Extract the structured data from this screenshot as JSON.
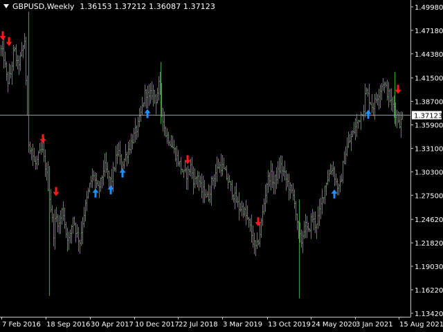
{
  "window": {
    "title": "GBPUSD,Weekly",
    "ohlc": "1.36153 1.37212 1.36087 1.37123"
  },
  "colors": {
    "background": "#000000",
    "bars": "#3f9b3a",
    "axis": "#c8c8c8",
    "text": "#ffffff",
    "price_line": "#8c9aa0",
    "price_tag_bg": "#ffffff",
    "price_tag_text": "#000000",
    "sell_arrow": "#ff1a1a",
    "buy_arrow": "#1e90ff"
  },
  "price_axis": {
    "labels": [
      "1.49980",
      "1.47180",
      "1.44380",
      "1.41500",
      "1.38700",
      "1.35900",
      "1.33100",
      "1.30300",
      "1.27500",
      "1.24620",
      "1.21820",
      "1.19030",
      "1.16220",
      "1.13420"
    ],
    "current_price": "1.37123"
  },
  "time_axis": {
    "labels": [
      "7 Feb 2016",
      "18 Sep 2016",
      "30 Apr 2017",
      "10 Dec 2017",
      "22 Jul 2018",
      "3 Mar 2019",
      "13 Oct 2019",
      "24 May 2020",
      "3 Jan 2021",
      "15 Aug 2021"
    ]
  },
  "chart_data": {
    "type": "bar",
    "symbol": "GBPUSD",
    "timeframe": "Weekly",
    "ylim": [
      1.13,
      1.508
    ],
    "price_line": 1.37123,
    "close_path": [
      [
        0,
        1.45
      ],
      [
        5,
        1.44
      ],
      [
        10,
        1.41
      ],
      [
        15,
        1.42
      ],
      [
        20,
        1.45
      ],
      [
        25,
        1.43
      ],
      [
        30,
        1.44
      ],
      [
        35,
        1.46
      ],
      [
        38,
        1.39
      ],
      [
        40,
        1.34
      ],
      [
        45,
        1.33
      ],
      [
        50,
        1.31
      ],
      [
        55,
        1.32
      ],
      [
        60,
        1.33
      ],
      [
        65,
        1.31
      ],
      [
        70,
        1.28
      ],
      [
        73,
        1.26
      ],
      [
        77,
        1.23
      ],
      [
        80,
        1.25
      ],
      [
        85,
        1.24
      ],
      [
        90,
        1.26
      ],
      [
        95,
        1.23
      ],
      [
        100,
        1.22
      ],
      [
        105,
        1.25
      ],
      [
        110,
        1.23
      ],
      [
        115,
        1.22
      ],
      [
        120,
        1.25
      ],
      [
        125,
        1.27
      ],
      [
        130,
        1.29
      ],
      [
        135,
        1.3
      ],
      [
        140,
        1.28
      ],
      [
        145,
        1.29
      ],
      [
        150,
        1.31
      ],
      [
        155,
        1.3
      ],
      [
        160,
        1.29
      ],
      [
        165,
        1.31
      ],
      [
        170,
        1.33
      ],
      [
        175,
        1.31
      ],
      [
        180,
        1.32
      ],
      [
        185,
        1.33
      ],
      [
        190,
        1.34
      ],
      [
        195,
        1.35
      ],
      [
        200,
        1.36
      ],
      [
        205,
        1.38
      ],
      [
        210,
        1.4
      ],
      [
        215,
        1.39
      ],
      [
        220,
        1.4
      ],
      [
        225,
        1.39
      ],
      [
        230,
        1.41
      ],
      [
        233,
        1.38
      ],
      [
        238,
        1.35
      ],
      [
        245,
        1.34
      ],
      [
        250,
        1.33
      ],
      [
        255,
        1.32
      ],
      [
        260,
        1.31
      ],
      [
        265,
        1.3
      ],
      [
        270,
        1.3
      ],
      [
        275,
        1.31
      ],
      [
        280,
        1.29
      ],
      [
        285,
        1.3
      ],
      [
        290,
        1.28
      ],
      [
        295,
        1.28
      ],
      [
        300,
        1.27
      ],
      [
        305,
        1.29
      ],
      [
        310,
        1.3
      ],
      [
        315,
        1.31
      ],
      [
        320,
        1.31
      ],
      [
        325,
        1.3
      ],
      [
        330,
        1.29
      ],
      [
        335,
        1.28
      ],
      [
        340,
        1.27
      ],
      [
        345,
        1.26
      ],
      [
        350,
        1.26
      ],
      [
        355,
        1.25
      ],
      [
        360,
        1.24
      ],
      [
        365,
        1.22
      ],
      [
        370,
        1.21
      ],
      [
        375,
        1.23
      ],
      [
        380,
        1.26
      ],
      [
        385,
        1.29
      ],
      [
        390,
        1.3
      ],
      [
        395,
        1.29
      ],
      [
        400,
        1.3
      ],
      [
        405,
        1.31
      ],
      [
        410,
        1.3
      ],
      [
        415,
        1.29
      ],
      [
        420,
        1.28
      ],
      [
        425,
        1.27
      ],
      [
        430,
        1.23
      ],
      [
        435,
        1.22
      ],
      [
        440,
        1.24
      ],
      [
        445,
        1.23
      ],
      [
        450,
        1.25
      ],
      [
        455,
        1.24
      ],
      [
        460,
        1.25
      ],
      [
        465,
        1.27
      ],
      [
        470,
        1.29
      ],
      [
        475,
        1.3
      ],
      [
        480,
        1.31
      ],
      [
        485,
        1.29
      ],
      [
        490,
        1.28
      ],
      [
        495,
        1.31
      ],
      [
        500,
        1.33
      ],
      [
        505,
        1.34
      ],
      [
        510,
        1.35
      ],
      [
        515,
        1.36
      ],
      [
        520,
        1.37
      ],
      [
        525,
        1.38
      ],
      [
        528,
        1.4
      ],
      [
        533,
        1.39
      ],
      [
        538,
        1.38
      ],
      [
        543,
        1.39
      ],
      [
        548,
        1.4
      ],
      [
        553,
        1.41
      ],
      [
        558,
        1.4
      ],
      [
        563,
        1.39
      ],
      [
        568,
        1.38
      ],
      [
        573,
        1.37
      ],
      [
        578,
        1.36
      ],
      [
        582,
        1.37
      ]
    ],
    "spikes": [
      {
        "x": 41,
        "high": 1.494,
        "low": 1.37
      },
      {
        "x": 71,
        "high": 1.31,
        "low": 1.155
      },
      {
        "x": 232,
        "high": 1.434,
        "low": 1.36
      },
      {
        "x": 432,
        "high": 1.27,
        "low": 1.152
      },
      {
        "x": 570,
        "high": 1.422,
        "low": 1.36
      }
    ],
    "sell_arrows": [
      {
        "x": 4,
        "price": 1.465
      },
      {
        "x": 13,
        "price": 1.458
      },
      {
        "x": 62,
        "price": 1.342
      },
      {
        "x": 81,
        "price": 1.279
      },
      {
        "x": 271,
        "price": 1.317
      },
      {
        "x": 373,
        "price": 1.243
      },
      {
        "x": 575,
        "price": 1.401
      }
    ],
    "buy_arrows": [
      {
        "x": 138,
        "price": 1.278
      },
      {
        "x": 160,
        "price": 1.282
      },
      {
        "x": 177,
        "price": 1.302
      },
      {
        "x": 213,
        "price": 1.373
      },
      {
        "x": 483,
        "price": 1.277
      },
      {
        "x": 532,
        "price": 1.372
      }
    ]
  }
}
